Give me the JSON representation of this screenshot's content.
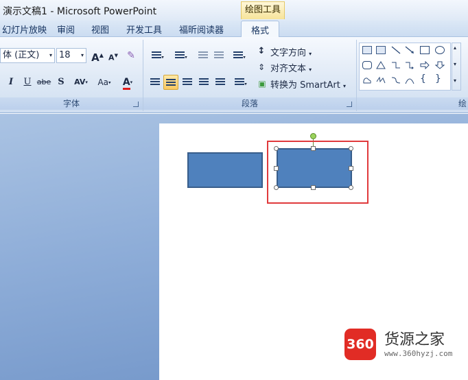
{
  "window": {
    "title": "演示文稿1 - Microsoft PowerPoint",
    "context_tab_title": "绘图工具"
  },
  "tabs": [
    {
      "label": "幻灯片放映"
    },
    {
      "label": "审阅"
    },
    {
      "label": "视图"
    },
    {
      "label": "开发工具"
    },
    {
      "label": "福昕阅读器"
    },
    {
      "label": "格式",
      "active": true
    }
  ],
  "font_group": {
    "label": "字体",
    "font_name": "体 (正文)",
    "font_size": "18",
    "grow_label": "A",
    "shrink_label": "A",
    "italic": "I",
    "underline": "U",
    "strike": "abe",
    "shadow": "S",
    "spacing": "AV",
    "case": "Aa",
    "color": "A",
    "font_color_hex": "#e01b1b"
  },
  "paragraph_group": {
    "label": "段落",
    "text_direction": "文字方向",
    "align_text": "对齐文本",
    "convert_smartart": "转换为 SmartArt",
    "selected_alignment": "center"
  },
  "drawing_group": {
    "label_partial": "绘"
  },
  "slide": {
    "shape_fill_hex": "#4f81bd",
    "shape_border_hex": "#385d8a",
    "highlight_hex": "#e0393b"
  },
  "watermark": {
    "logo_text": "360",
    "name": "货源之家",
    "url": "www.360hyzj.com"
  }
}
